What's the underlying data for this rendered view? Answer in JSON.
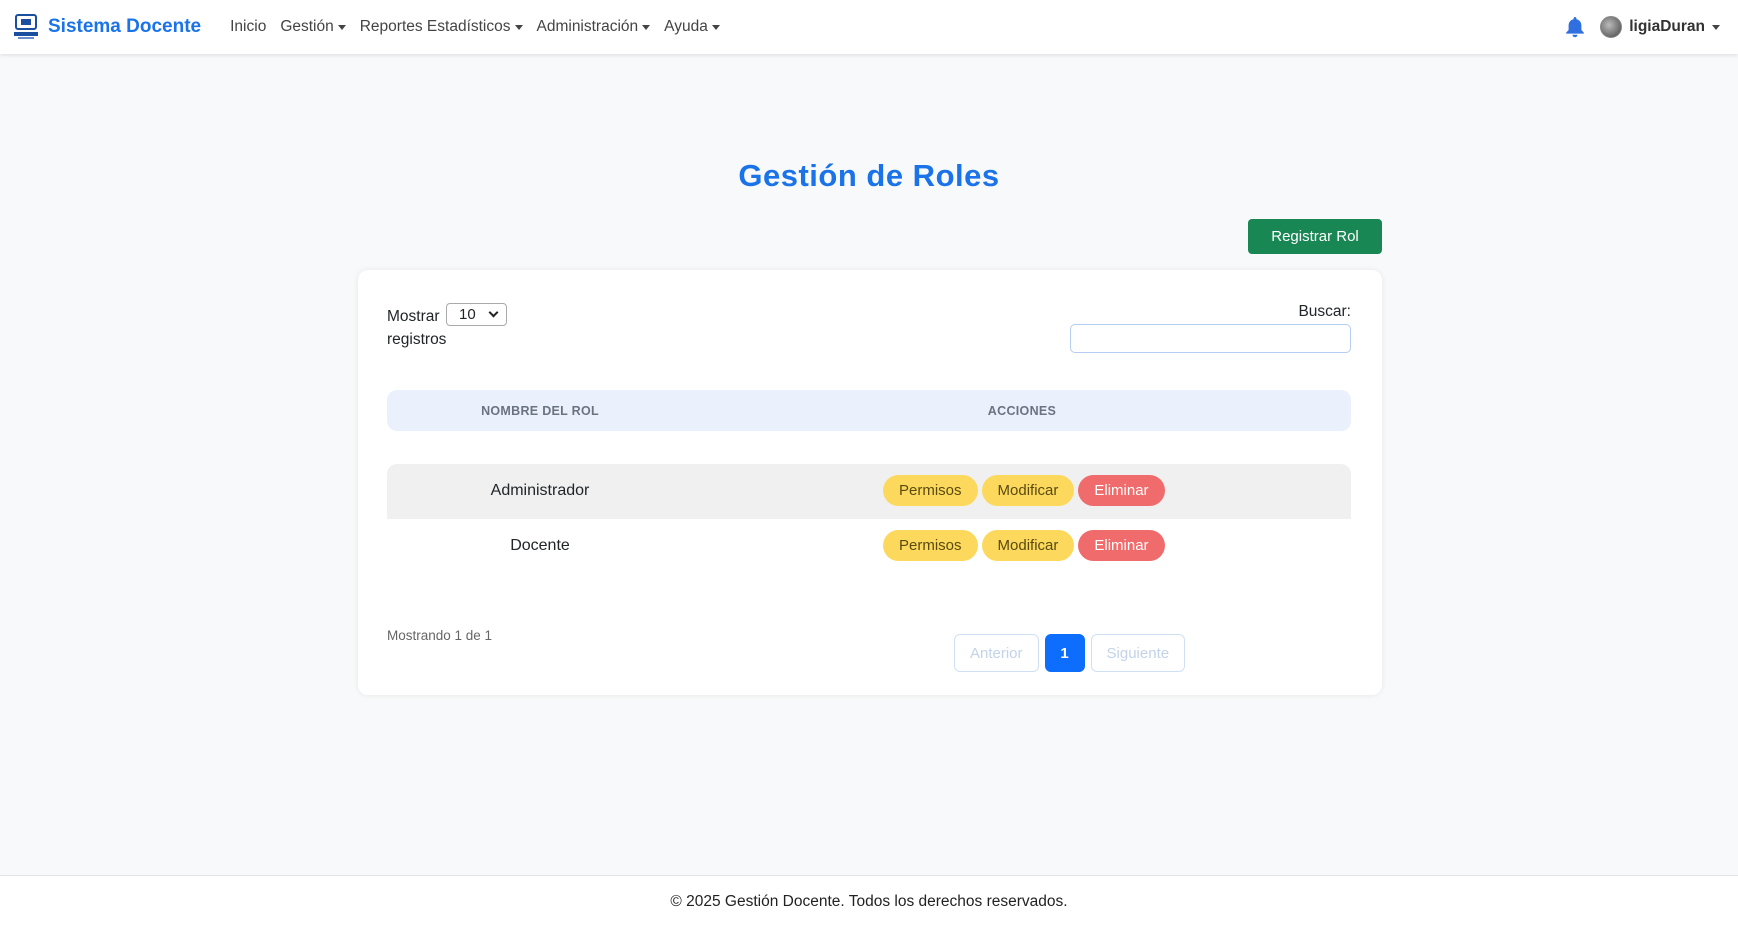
{
  "navbar": {
    "brand_name": "Sistema Docente",
    "brand_logo_text": "UPTAEB",
    "links": [
      {
        "label": "Inicio",
        "dropdown": false
      },
      {
        "label": "Gestión",
        "dropdown": true
      },
      {
        "label": "Reportes Estadísticos",
        "dropdown": true
      },
      {
        "label": "Administración",
        "dropdown": true
      },
      {
        "label": "Ayuda",
        "dropdown": true
      }
    ],
    "username": "ligiaDuran"
  },
  "page": {
    "title": "Gestión de Roles",
    "register_button": "Registrar Rol"
  },
  "table_controls": {
    "length_label_before": "Mostrar",
    "length_value": "10",
    "length_label_after": "registros",
    "search_label": "Buscar:",
    "search_value": ""
  },
  "table": {
    "columns": [
      "NOMBRE DEL ROL",
      "ACCIONES"
    ],
    "rows": [
      {
        "name": "Administrador",
        "actions": [
          "Permisos",
          "Modificar",
          "Eliminar"
        ]
      },
      {
        "name": "Docente",
        "actions": [
          "Permisos",
          "Modificar",
          "Eliminar"
        ]
      }
    ]
  },
  "pagination": {
    "info": "Mostrando 1 de 1",
    "previous": "Anterior",
    "current": "1",
    "next": "Siguiente"
  },
  "footer": {
    "text": "© 2025 Gestión Docente. Todos los derechos reservados."
  },
  "colors": {
    "brand": "#1a73e8",
    "success": "#198754",
    "warning": "#fcd95c",
    "danger": "#f06b6b",
    "primary": "#0d6efd"
  },
  "icons": {
    "notification": "bell-icon",
    "logo": "uptaeb-logo-icon"
  }
}
